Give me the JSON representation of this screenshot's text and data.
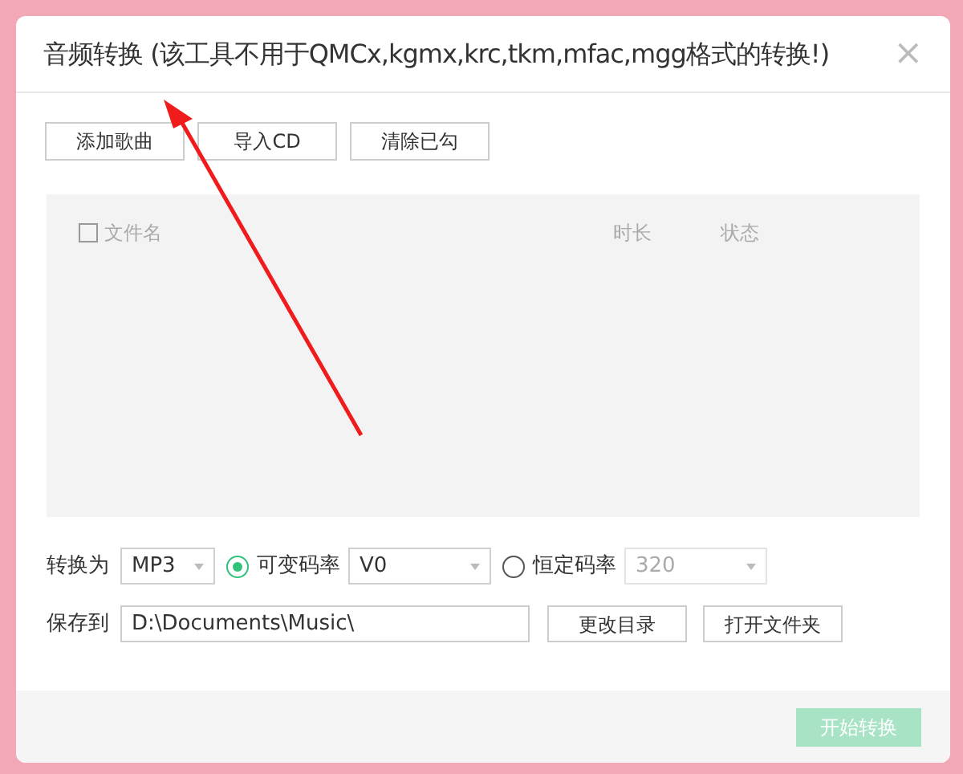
{
  "dialog": {
    "title": "音频转换 (该工具不用于QMCx,kgmx,krc,tkm,mfac,mgg格式的转换!)",
    "close": "×"
  },
  "toolbar": [
    "添加歌曲",
    "导入CD",
    "清除已勾"
  ],
  "table": {
    "select_all": {
      "checked": false
    },
    "columns": [
      "文件名",
      "时长",
      "状态"
    ]
  },
  "format": {
    "label": "转换为",
    "value": "MP3"
  },
  "bitrate_modes": [
    {
      "label": "可变码率",
      "selected": true,
      "value": "V0"
    },
    {
      "label": "恒定码率",
      "selected": false,
      "value": "320"
    }
  ],
  "save": {
    "label": "保存到",
    "value": "D:\\Documents\\Music\\",
    "buttons": [
      "更改目录",
      "打开文件夹"
    ]
  },
  "start": {
    "label": "开始转换",
    "disabled": true
  }
}
